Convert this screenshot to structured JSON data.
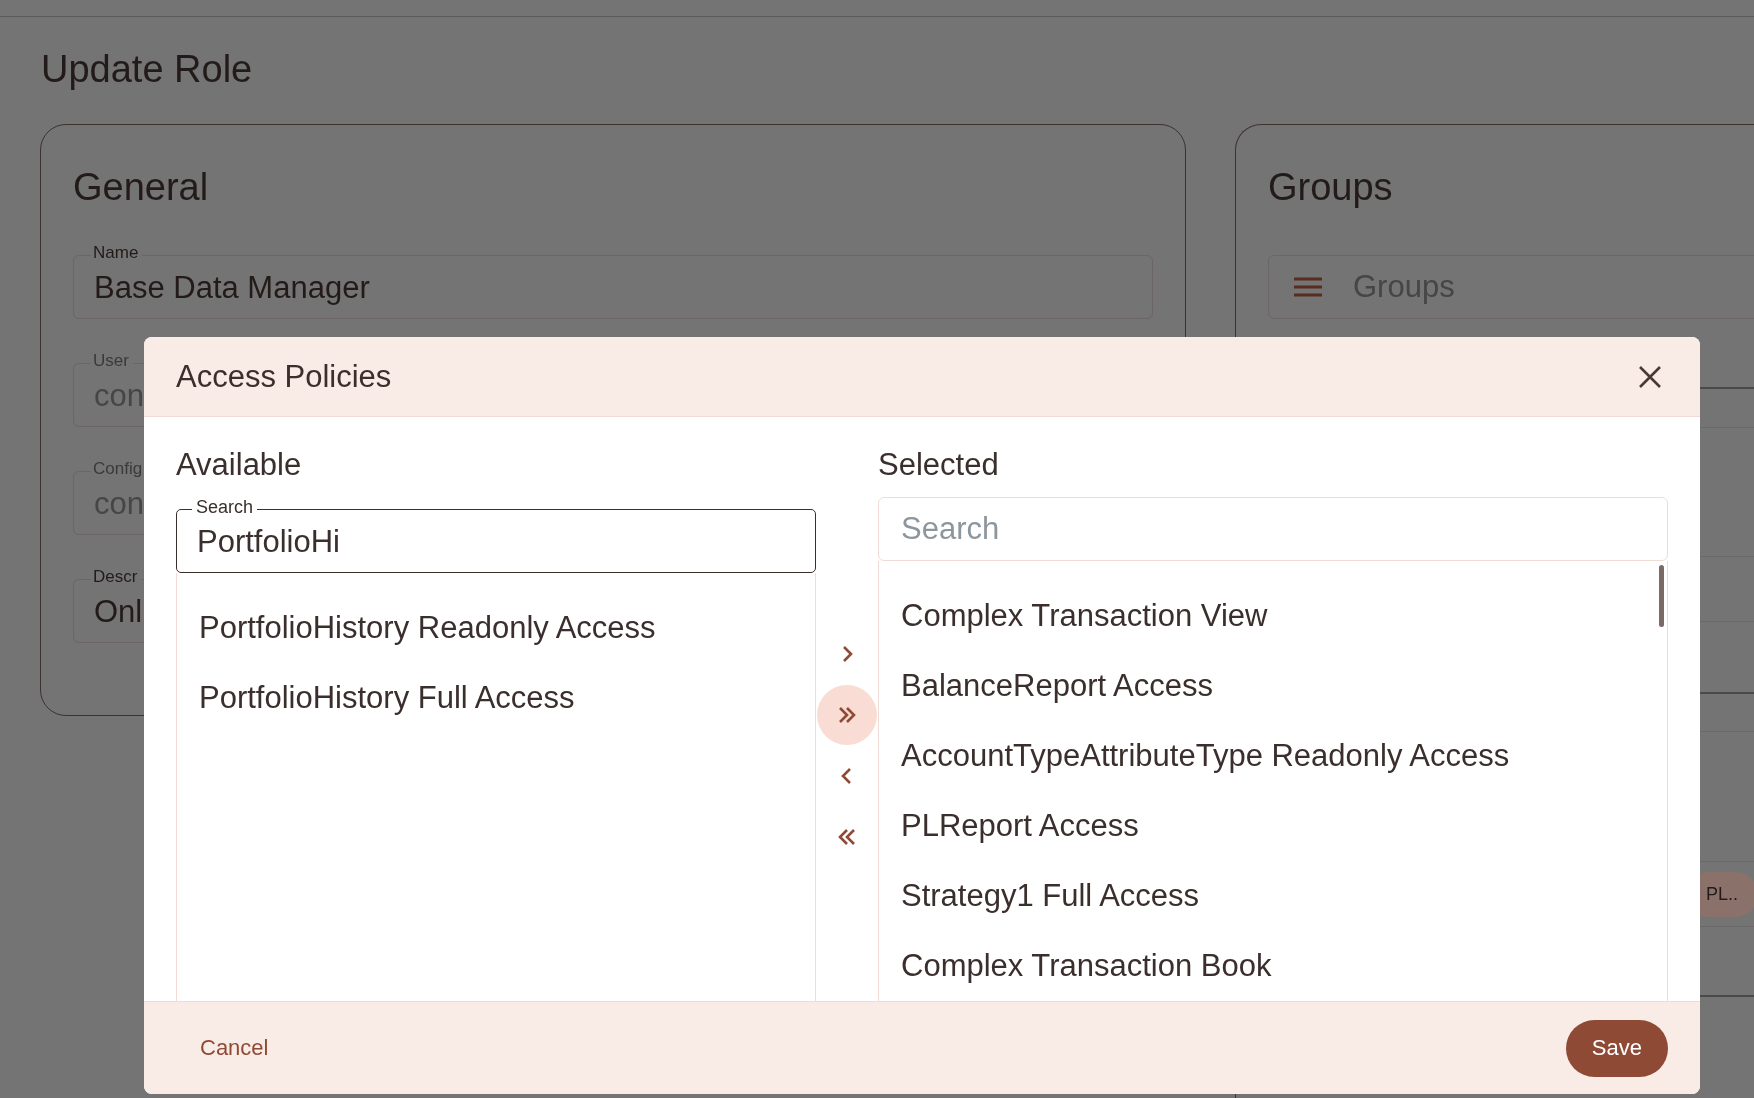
{
  "page": {
    "title": "Update Role"
  },
  "general": {
    "title": "General",
    "fields": [
      {
        "label": "Name",
        "value": "Base Data Manager"
      },
      {
        "label": "User",
        "placeholder": "con"
      },
      {
        "label": "Config",
        "placeholder": "con"
      },
      {
        "label": "Descr",
        "value": "Onl"
      }
    ]
  },
  "groups": {
    "title": "Groups",
    "field": {
      "placeholder": "Groups"
    },
    "chips": [
      "PL.."
    ]
  },
  "dialog": {
    "title": "Access Policies",
    "available": {
      "heading": "Available",
      "search": {
        "label": "Search",
        "value": "PortfolioHi"
      },
      "items": [
        "PortfolioHistory Readonly Access",
        "PortfolioHistory Full Access"
      ]
    },
    "transfer_buttons": [
      {
        "kind": "move-one-right",
        "highlighted": false
      },
      {
        "kind": "move-all-right",
        "highlighted": true
      },
      {
        "kind": "move-one-left",
        "highlighted": false
      },
      {
        "kind": "move-all-left",
        "highlighted": false
      }
    ],
    "selected": {
      "heading": "Selected",
      "search": {
        "placeholder": "Search"
      },
      "items": [
        "Complex Transaction View",
        "BalanceReport Access",
        "AccountTypeAttributeType Readonly Access",
        "PLReport Access",
        "Strategy1 Full Access",
        "Complex Transaction Book"
      ]
    },
    "buttons": {
      "cancel": "Cancel",
      "save": "Save"
    }
  }
}
